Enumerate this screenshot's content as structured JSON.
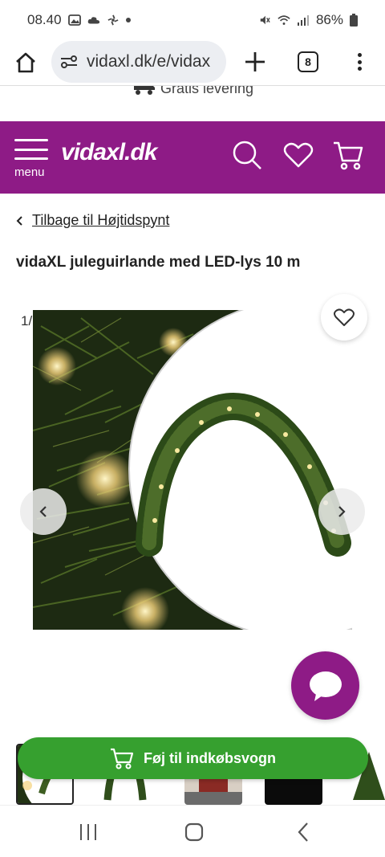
{
  "status_bar": {
    "time": "08.40",
    "battery": "86%",
    "icons": [
      "image-icon",
      "cloud-icon",
      "pinwheel-icon",
      "dot-icon",
      "mute-icon",
      "wifi-icon",
      "signal-icon",
      "battery-icon"
    ]
  },
  "browser": {
    "url": "vidaxl.dk/e/vidax",
    "tab_count": "8"
  },
  "delivery": {
    "text": "Gratis levering"
  },
  "header": {
    "logo": "vidaxl.dk",
    "menu_label": "menu",
    "brand_color": "#8e1b86"
  },
  "breadcrumb": {
    "back_icon": "chevron-left-icon",
    "link": "Tilbage til Højtidspynt"
  },
  "product": {
    "title": "vidaXL juleguirlande med LED-lys 10 m",
    "image_counter": "1/"
  },
  "cart": {
    "label": "Føj til indkøbsvogn",
    "color": "#36a02f"
  },
  "thumbnails": [
    {
      "name": "thumbnail-closeup",
      "active": true
    },
    {
      "name": "thumbnail-garland"
    },
    {
      "name": "thumbnail-garland-2"
    },
    {
      "name": "thumbnail-house-door"
    },
    {
      "name": "thumbnail-night-lights"
    },
    {
      "name": "thumbnail-tree"
    }
  ]
}
